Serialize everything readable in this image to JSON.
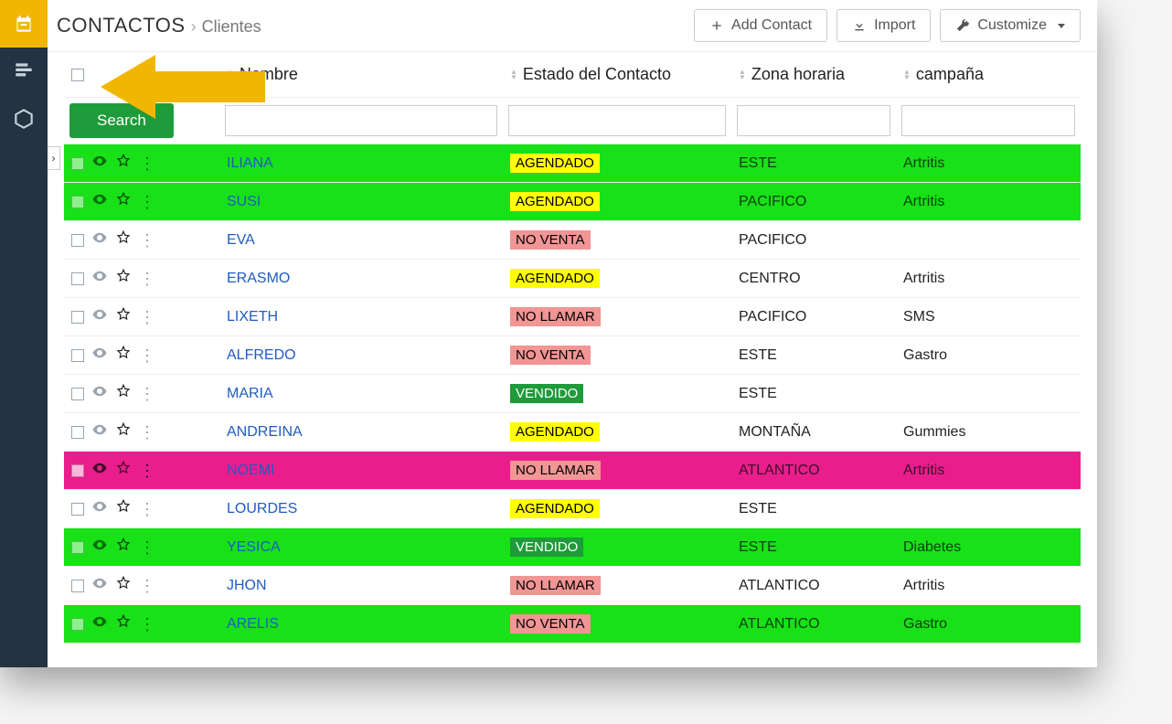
{
  "breadcrumb": {
    "title": "CONTACTOS",
    "page": "Clientes"
  },
  "actions": {
    "add": "Add Contact",
    "import": "Import",
    "customize": "Customize"
  },
  "columns": {
    "name": "Nombre",
    "status": "Estado del Contacto",
    "tz": "Zona horaria",
    "camp": "campaña"
  },
  "search_label": "Search",
  "status_styles": {
    "AGENDADO": "badge-yellow",
    "NO VENTA": "badge-red",
    "NO LLAMAR": "badge-red",
    "VENDIDO": "badge-green"
  },
  "rows": [
    {
      "name": "ILIANA",
      "status": "AGENDADO",
      "tz": "ESTE",
      "camp": "Artritis",
      "row": "green"
    },
    {
      "name": "SUSI",
      "status": "AGENDADO",
      "tz": "PACIFICO",
      "camp": "Artritis",
      "row": "green"
    },
    {
      "name": "EVA",
      "status": "NO VENTA",
      "tz": "PACIFICO",
      "camp": "",
      "row": ""
    },
    {
      "name": "ERASMO",
      "status": "AGENDADO",
      "tz": "CENTRO",
      "camp": "Artritis",
      "row": ""
    },
    {
      "name": "LIXETH",
      "status": "NO LLAMAR",
      "tz": "PACIFICO",
      "camp": "SMS",
      "row": ""
    },
    {
      "name": "ALFREDO",
      "status": "NO VENTA",
      "tz": "ESTE",
      "camp": "Gastro",
      "row": ""
    },
    {
      "name": "MARIA",
      "status": "VENDIDO",
      "tz": "ESTE",
      "camp": "",
      "row": ""
    },
    {
      "name": "ANDREINA",
      "status": "AGENDADO",
      "tz": "MONTAÑA",
      "camp": "Gummies",
      "row": ""
    },
    {
      "name": "NOEMI",
      "status": "NO LLAMAR",
      "tz": "ATLANTICO",
      "camp": "Artritis",
      "row": "pink"
    },
    {
      "name": "LOURDES",
      "status": "AGENDADO",
      "tz": "ESTE",
      "camp": "",
      "row": ""
    },
    {
      "name": "YESICA",
      "status": "VENDIDO",
      "tz": "ESTE",
      "camp": "Diabetes",
      "row": "green"
    },
    {
      "name": "JHON",
      "status": "NO LLAMAR",
      "tz": "ATLANTICO",
      "camp": "Artritis",
      "row": ""
    },
    {
      "name": "ARELIS",
      "status": "NO VENTA",
      "tz": "ATLANTICO",
      "camp": "Gastro",
      "row": "green"
    }
  ]
}
